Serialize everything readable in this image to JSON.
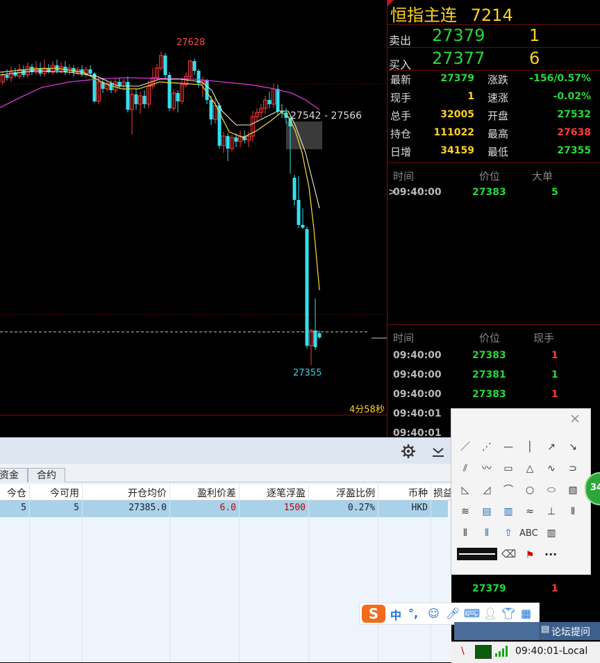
{
  "chart": {
    "high_label": "27628",
    "low_label": "27355",
    "range_label": "27542 - 27566",
    "timer_label": "4分58秒"
  },
  "quote": {
    "title": "恒指主连",
    "code": "7214",
    "sell": {
      "label": "卖出",
      "price": "27379",
      "qty": "1"
    },
    "buy": {
      "label": "买入",
      "price": "27377",
      "qty": "6"
    },
    "stats_left": [
      {
        "label": "最新",
        "value": "27379",
        "color": "#27d83a"
      },
      {
        "label": "现手",
        "value": "1",
        "color": "#ffd21f"
      },
      {
        "label": "总手",
        "value": "32005",
        "color": "#ffd21f"
      },
      {
        "label": "持仓",
        "value": "111022",
        "color": "#ffd21f"
      },
      {
        "label": "日增",
        "value": "34159",
        "color": "#ffd21f"
      }
    ],
    "stats_right": [
      {
        "label": "涨跌",
        "value": "-156/0.57%",
        "color": "#27d83a"
      },
      {
        "label": "速涨",
        "value": "-0.02%",
        "color": "#27d83a"
      },
      {
        "label": "开盘",
        "value": "27532",
        "color": "#27d83a"
      },
      {
        "label": "最高",
        "value": "27638",
        "color": "#ff3b3b"
      },
      {
        "label": "最低",
        "value": "27355",
        "color": "#27d83a"
      }
    ],
    "bigorder_headers": {
      "time": "时间",
      "price": "价位",
      "size": "大单"
    },
    "bigorder_rows": [
      {
        "time": "09:40:00",
        "price": "27383",
        "size": "5"
      }
    ],
    "tick_headers": {
      "time": "时间",
      "price": "价位",
      "qty": "现手"
    },
    "tick_rows": [
      {
        "time": "09:40:00",
        "price": "27383",
        "qty": "1",
        "qcolor": "#ff3b3b"
      },
      {
        "time": "09:40:00",
        "price": "27381",
        "qty": "1",
        "qcolor": "#27d83a"
      },
      {
        "time": "09:40:00",
        "price": "27383",
        "qty": "1",
        "qcolor": "#ff3b3b"
      },
      {
        "time": "09:40:01",
        "price": "",
        "qty": "",
        "qcolor": "#ff3b3b"
      },
      {
        "time": "09:40:01",
        "price": "",
        "qty": "",
        "qcolor": "#ff3b3b"
      }
    ],
    "last_tick": {
      "price": "27379",
      "qty": "1"
    }
  },
  "positions": {
    "tabs": [
      "资金",
      "合约"
    ],
    "headers": [
      "今仓",
      "今可用",
      "开仓均价",
      "盈利价差",
      "逐笔浮盈",
      "浮盈比例",
      "币种",
      "损益"
    ],
    "row": [
      "5",
      "5",
      "27385.0",
      "6.0",
      "1500",
      "0.27%",
      "HKD"
    ],
    "row_colors": [
      "#222",
      "#222",
      "#222",
      "#c00000",
      "#c00000",
      "#222",
      "#222"
    ]
  },
  "status": {
    "forum_label": "论坛提问",
    "clock": "09:40:01-Local",
    "badge": "34"
  },
  "ime": {
    "lang": "中",
    "punct": "°,"
  },
  "tools": {
    "text_tool": "ABC",
    "more": "···"
  }
}
